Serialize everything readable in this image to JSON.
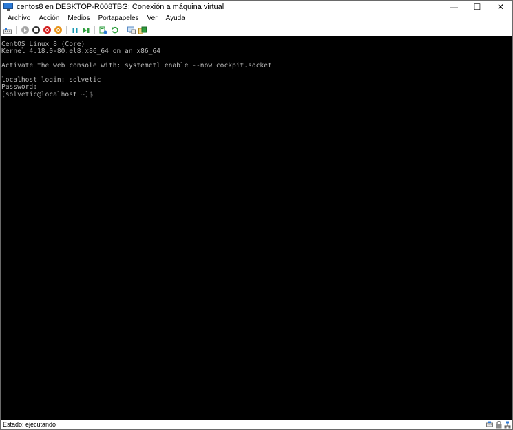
{
  "window": {
    "title": "centos8 en DESKTOP-R008TBG: Conexión a máquina virtual",
    "minimize_glyph": "—",
    "maximize_glyph": "☐",
    "close_glyph": "✕"
  },
  "menu": {
    "items": [
      "Archivo",
      "Acción",
      "Medios",
      "Portapapeles",
      "Ver",
      "Ayuda"
    ]
  },
  "toolbar": {
    "icons": [
      "ctrl-alt-del-icon",
      "start-icon",
      "turn-off-icon",
      "shutdown-icon",
      "save-state-icon",
      "pause-icon",
      "reset-icon",
      "checkpoint-icon",
      "revert-icon",
      "enhanced-session-icon",
      "share-icon"
    ],
    "colors": {
      "gray": "#8c8c8c",
      "dark": "#333333",
      "red": "#d21f1f",
      "orange": "#e8941a",
      "teal": "#1b9ab4",
      "green": "#2e9e3d",
      "blue": "#2b79d6"
    }
  },
  "console": {
    "lines": [
      "CentOS Linux 8 (Core)",
      "Kernel 4.18.0-80.el8.x86_64 on an x86_64",
      "",
      "Activate the web console with: systemctl enable --now cockpit.socket",
      "",
      "localhost login: solvetic",
      "Password:",
      "[solvetic@localhost ~]$ "
    ],
    "background": "#000000",
    "foreground": "#b8b8b8"
  },
  "status": {
    "text": "Estado: ejecutando",
    "icons": [
      "keyboard-icon",
      "lock-icon",
      "network-icon"
    ]
  }
}
